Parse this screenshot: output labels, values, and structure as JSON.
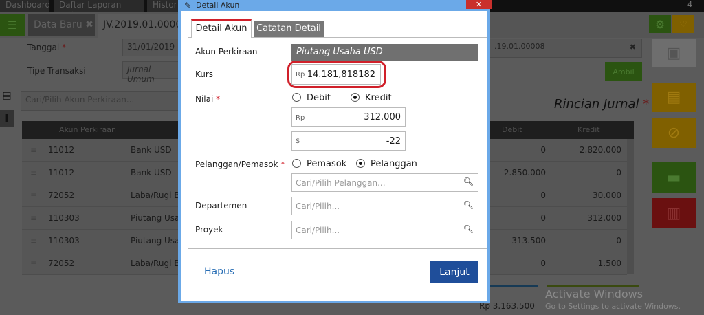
{
  "top_tabs": [
    "Dashboard",
    "Daftar Laporan",
    "Histor"
  ],
  "top_badge": "4",
  "sub_tabs": {
    "new": "Data Baru",
    "current": "JV.2019.01.00008"
  },
  "form": {
    "tanggal_label": "Tanggal",
    "tanggal_value": "31/01/2019",
    "tipe_label": "Tipe Transaksi",
    "tipe_value": "Jurnal Umum",
    "ref_value": ".19.01.00008",
    "ambil": "Ambil"
  },
  "search_placeholder": "Cari/Pilih Akun Perkiraan...",
  "rincian": "Rincian Jurnal",
  "table": {
    "headers": [
      "Akun Perkiraan",
      "",
      "Debit",
      "Kredit"
    ],
    "rows": [
      {
        "code": "11012",
        "name": "Bank USD",
        "debit": "0",
        "kredit": "2.820.000"
      },
      {
        "code": "11012",
        "name": "Bank USD",
        "debit": "2.850.000",
        "kredit": "0"
      },
      {
        "code": "72052",
        "name": "Laba/Rugi B",
        "debit": "0",
        "kredit": "30.000"
      },
      {
        "code": "110303",
        "name": "Piutang Usa",
        "debit": "0",
        "kredit": "312.000"
      },
      {
        "code": "110303",
        "name": "Piutang Usa",
        "debit": "313.500",
        "kredit": "0"
      },
      {
        "code": "72052",
        "name": "Laba/Rugi B",
        "debit": "0",
        "kredit": "1.500"
      }
    ]
  },
  "total": "Rp 3.163.500",
  "watermark": {
    "title": "Activate Windows",
    "sub": "Go to Settings to activate Windows."
  },
  "modal": {
    "title": "Detail Akun",
    "tabs": [
      "Detail Akun",
      "Catatan Detail"
    ],
    "akun_label": "Akun Perkiraan",
    "akun_value": "Piutang Usaha USD",
    "kurs_label": "Kurs",
    "kurs_prefix": "Rp",
    "kurs_value": "14.181,818182",
    "nilai_label": "Nilai",
    "debit": "Debit",
    "kredit": "Kredit",
    "selected_nilai": "Kredit",
    "nilai_prefix": "Rp",
    "nilai_value": "312.000",
    "usd_prefix": "$",
    "usd_value": "-22",
    "pel_label": "Pelanggan/Pemasok",
    "pemasok": "Pemasok",
    "pelanggan": "Pelanggan",
    "selected_pel": "Pelanggan",
    "pel_placeholder": "Cari/Pilih Pelanggan...",
    "dept_label": "Departemen",
    "dept_placeholder": "Cari/Pilih...",
    "proyek_label": "Proyek",
    "proyek_placeholder": "Cari/Pilih...",
    "hapus": "Hapus",
    "lanjut": "Lanjut"
  },
  "colors": {
    "accent": "#1f4e9a",
    "highlight": "#d0202a",
    "titlebar": "#6ba9e8"
  }
}
